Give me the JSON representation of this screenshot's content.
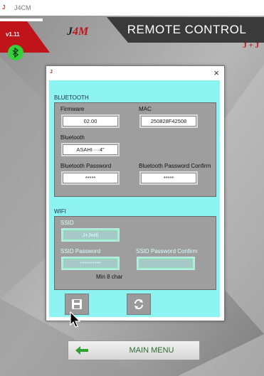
{
  "window": {
    "title": "J4CM"
  },
  "header": {
    "version": "v1.11",
    "logo": "J4M",
    "title": "REMOTE CONTROL",
    "brand": "J+J"
  },
  "dialog": {
    "bluetooth_section": {
      "heading": "BLUETOOTH",
      "firmware": {
        "label": "Firmware",
        "value": "02.00"
      },
      "mac": {
        "label": "MAC",
        "value": "250828F42508"
      },
      "bluetooth": {
        "label": "Bluetooth",
        "value": "ASAHI····4\""
      },
      "password": {
        "label": "Bluetooth Password",
        "value": "*****"
      },
      "password_confirm": {
        "label": "Bluetooth Password Confirm",
        "value": "*****"
      }
    },
    "wifi_section": {
      "heading": "WIFI",
      "ssid": {
        "label": "SSID",
        "value": "J+Jwifi"
      },
      "ssid_password": {
        "label": "SSID Password",
        "value": "**********"
      },
      "ssid_password_confirm": {
        "label": "SSID Password Confirm",
        "value": ""
      },
      "min_note": "Min 8 char"
    },
    "close_glyph": "×"
  },
  "footer": {
    "main_menu_label": "MAIN MENU"
  },
  "icons": {
    "bluetooth": "bluetooth-icon",
    "save": "save-icon",
    "refresh": "refresh-icon",
    "back": "arrow-left-icon"
  },
  "colors": {
    "accent_red": "#c0141b",
    "dialog_body": "#8ef4f2",
    "bt_green": "#35d13a",
    "menu_text": "#2f6b2f"
  }
}
